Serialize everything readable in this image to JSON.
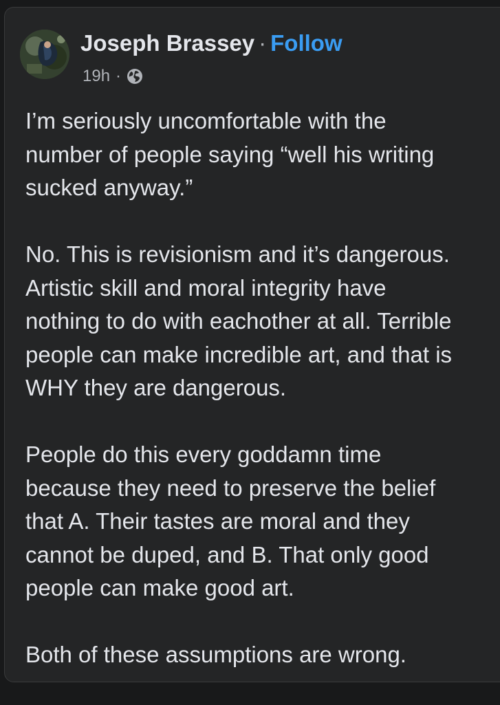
{
  "post": {
    "author": "Joseph Brassey",
    "separator": "·",
    "follow_label": "Follow",
    "timestamp": "19h",
    "meta_separator": "·",
    "privacy_icon": "globe-icon",
    "paragraphs": [
      {
        "lines": [
          "I’m seriously uncomfortable with the",
          "number of people saying “well his writing",
          "sucked anyway.”"
        ]
      },
      {
        "lines": [
          "No. This is revisionism and it’s dangerous.",
          "Artistic skill and moral integrity have",
          "nothing to do with eachother at all. Terrible",
          "people can make incredible art, and that is",
          "WHY they are dangerous."
        ]
      },
      {
        "lines": [
          "People do this every goddamn time",
          "because they need to preserve the belief",
          "that A. Their tastes are moral and they",
          "cannot be duped, and B. That only good",
          "people can make good art."
        ]
      },
      {
        "lines": [
          "Both of these assumptions are wrong."
        ]
      }
    ]
  },
  "colors": {
    "background": "#242526",
    "text": "#e4e6eb",
    "secondary_text": "#b0b3b8",
    "link": "#3a9cf2"
  }
}
